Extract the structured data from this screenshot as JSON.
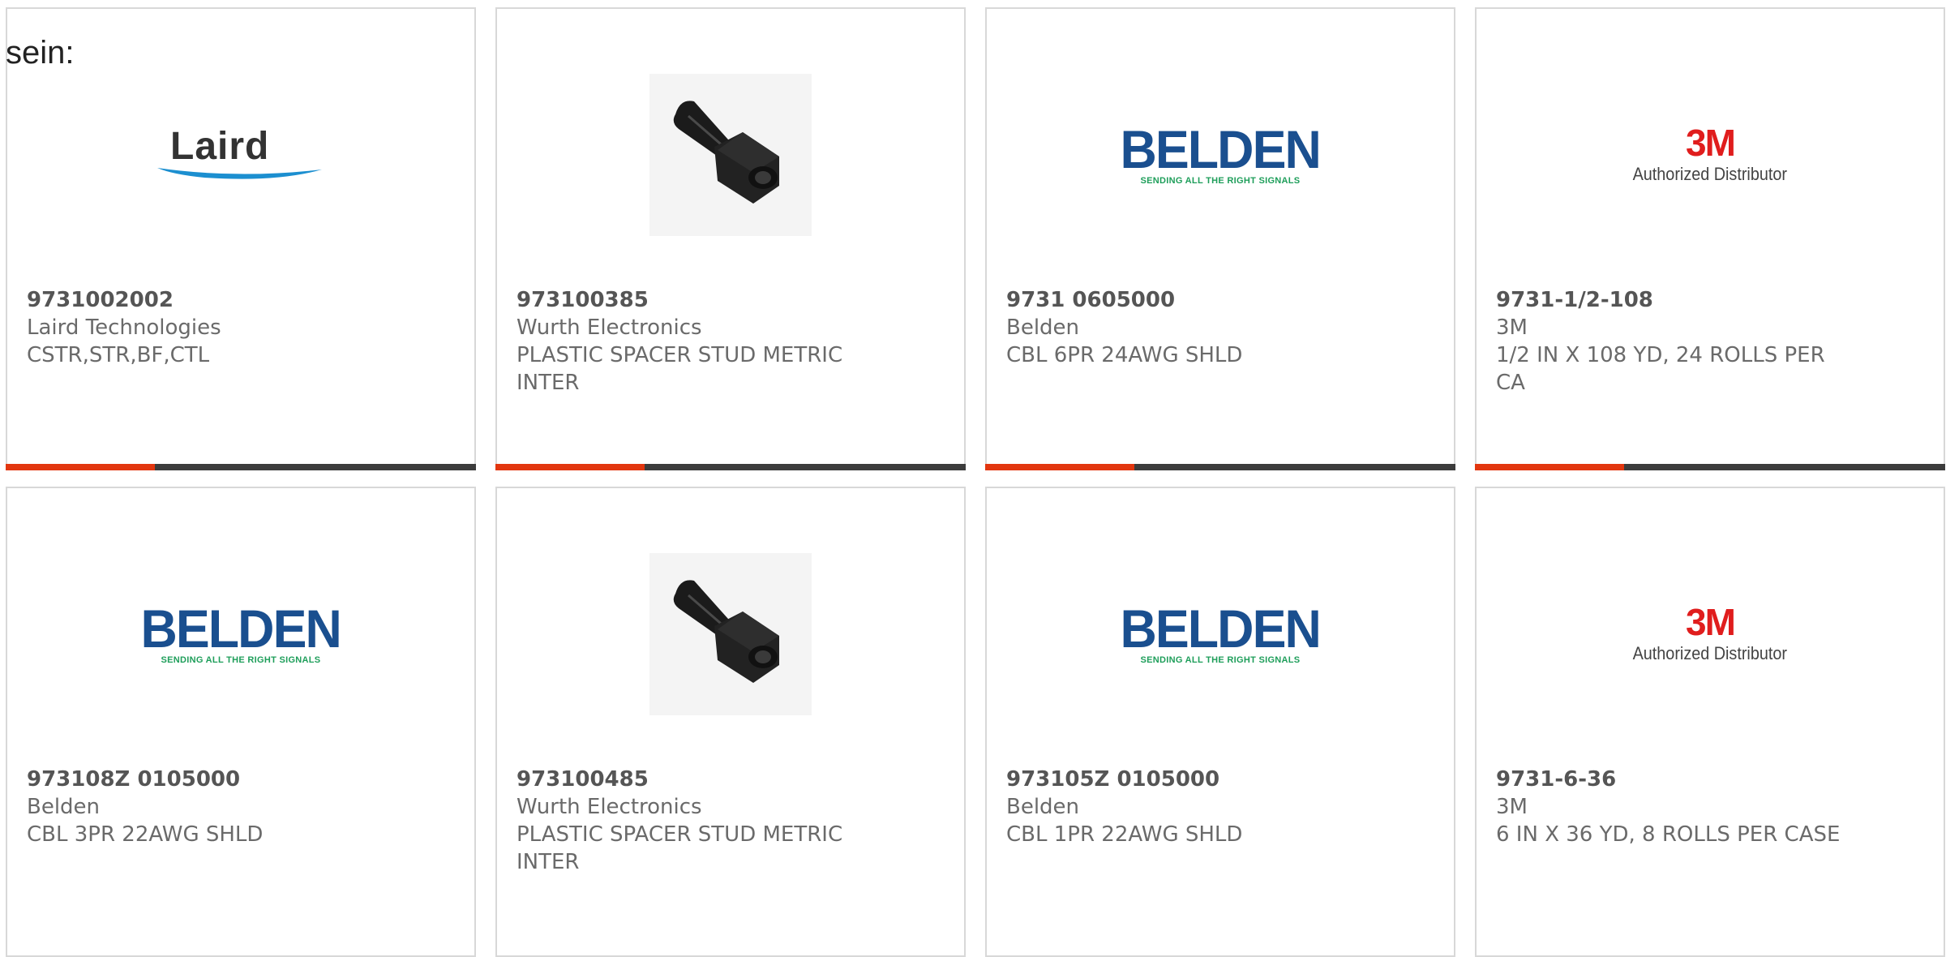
{
  "intro_text": "sein:",
  "logos": {
    "laird": "Laird",
    "belden": "BELDEN",
    "belden_tagline": "SENDING ALL THE RIGHT SIGNALS",
    "three_m": "3M",
    "three_m_tagline": "Authorized Distributor"
  },
  "colors": {
    "accent": "#e2360f",
    "bar_dark": "#3c3c3c",
    "belden_blue": "#1a4f8f",
    "belden_green": "#1e9e5a",
    "three_m_red": "#e01d1d"
  },
  "products": [
    {
      "part_number": "9731002002",
      "manufacturer": "Laird Technologies",
      "description": "CSTR,STR,BF,CTL",
      "image": "laird-logo"
    },
    {
      "part_number": "973100385",
      "manufacturer": "Wurth Electronics",
      "description": "PLASTIC SPACER STUD METRIC INTER",
      "image": "plastic-spacer-photo"
    },
    {
      "part_number": "9731 0605000",
      "manufacturer": "Belden",
      "description": "CBL 6PR 24AWG SHLD",
      "image": "belden-logo"
    },
    {
      "part_number": "9731-1/2-108",
      "manufacturer": "3M",
      "description": "1/2 IN X 108 YD, 24 ROLLS PER CA",
      "image": "3m-logo"
    },
    {
      "part_number": "973108Z 0105000",
      "manufacturer": "Belden",
      "description": "CBL 3PR 22AWG SHLD",
      "image": "belden-logo"
    },
    {
      "part_number": "973100485",
      "manufacturer": "Wurth Electronics",
      "description": "PLASTIC SPACER STUD METRIC INTER",
      "image": "plastic-spacer-photo"
    },
    {
      "part_number": "973105Z 0105000",
      "manufacturer": "Belden",
      "description": "CBL 1PR 22AWG SHLD",
      "image": "belden-logo"
    },
    {
      "part_number": "9731-6-36",
      "manufacturer": "3M",
      "description": "6 IN X 36 YD, 8 ROLLS PER CASE",
      "image": "3m-logo"
    }
  ]
}
